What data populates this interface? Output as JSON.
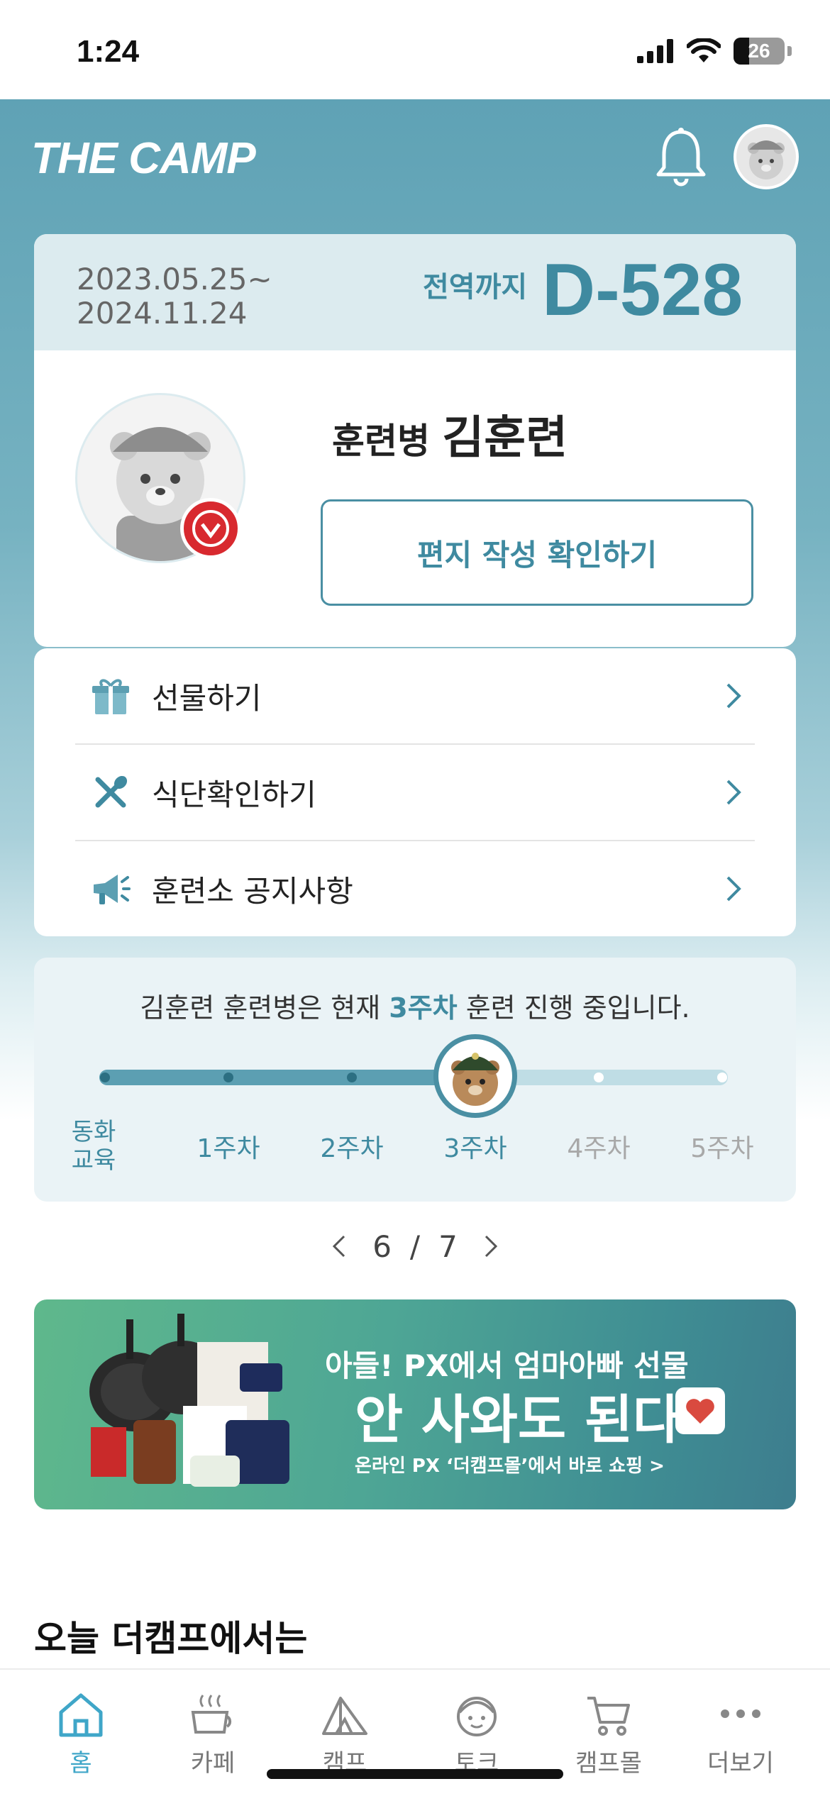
{
  "status_bar": {
    "time": "1:24",
    "battery": "26"
  },
  "header": {
    "logo": "THE CAMP"
  },
  "service_card": {
    "date_start": "2023.05.25~",
    "date_end": "2024.11.24",
    "dday_label": "전역까지",
    "dday_value": "D-528",
    "rank": "훈련병",
    "name": "김훈련",
    "letter_button": "편지 작성 확인하기"
  },
  "menu": {
    "items": [
      {
        "label": "선물하기",
        "icon": "gift-icon"
      },
      {
        "label": "식단확인하기",
        "icon": "utensils-icon"
      },
      {
        "label": "훈련소 공지사항",
        "icon": "megaphone-icon"
      }
    ]
  },
  "progress": {
    "text_prefix": "김훈련 훈련병은 현재 ",
    "text_highlight": "3주차",
    "text_suffix": " 훈련 진행 중입니다.",
    "current_index": 3,
    "weeks": [
      "동화\n교육",
      "1주차",
      "2주차",
      "3주차",
      "4주차",
      "5주차"
    ]
  },
  "pager": {
    "current": "6",
    "separator": "/",
    "total": "7"
  },
  "banner": {
    "headline": "아들! PX에서 엄마아빠 선물",
    "main": "안 사와도 된다",
    "sub": "온라인 PX ‘더캠프몰’에서 바로 쇼핑 >"
  },
  "section": {
    "title": "오늘 더캠프에서는"
  },
  "tabbar": {
    "tabs": [
      {
        "label": "홈",
        "icon": "home-icon",
        "active": true
      },
      {
        "label": "카페",
        "icon": "coffee-icon",
        "active": false
      },
      {
        "label": "캠프",
        "icon": "tent-icon",
        "active": false
      },
      {
        "label": "토크",
        "icon": "face-icon",
        "active": false
      },
      {
        "label": "캠프몰",
        "icon": "cart-icon",
        "active": false
      },
      {
        "label": "더보기",
        "icon": "more-icon",
        "active": false
      }
    ]
  },
  "colors": {
    "accent": "#3f8aa0",
    "header_bg": "#5fa2b5",
    "tab_active": "#3fa6c8"
  }
}
